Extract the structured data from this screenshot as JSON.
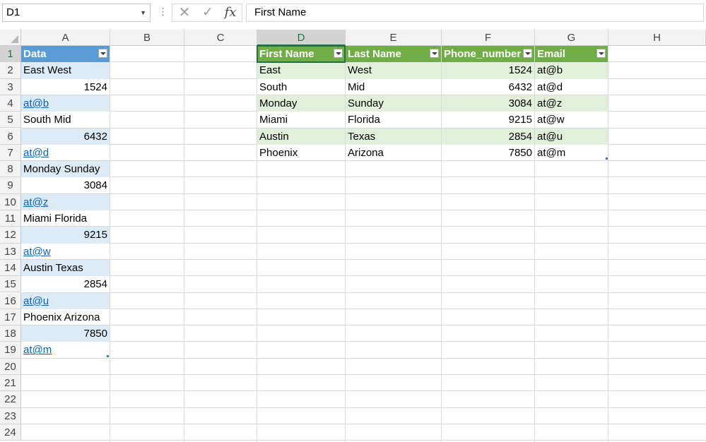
{
  "formula_bar": {
    "name_box": "D1",
    "cancel_icon": "✕",
    "enter_icon": "✓",
    "fx_label": "fx",
    "content": "First Name"
  },
  "columns": [
    "A",
    "B",
    "C",
    "D",
    "E",
    "F",
    "G",
    "H"
  ],
  "rows": [
    "1",
    "2",
    "3",
    "4",
    "5",
    "6",
    "7",
    "8",
    "9",
    "10",
    "11",
    "12",
    "13",
    "14",
    "15",
    "16",
    "17",
    "18",
    "19",
    "20",
    "21",
    "22",
    "23",
    "24"
  ],
  "column_a": {
    "header": "Data",
    "values": [
      "East West",
      "1524",
      "at@b",
      "South Mid",
      "6432",
      "at@d",
      "Monday Sunday",
      "3084",
      "at@z",
      "Miami Florida",
      "9215",
      "at@w",
      "Austin Texas",
      "2854",
      "at@u",
      "Phoenix Arizona",
      "7850",
      "at@m"
    ]
  },
  "table": {
    "headers": [
      "First Name",
      "Last Name",
      "Phone_number",
      "Email"
    ],
    "rows": [
      [
        "East",
        "West",
        "1524",
        "at@b"
      ],
      [
        "South",
        "Mid",
        "6432",
        "at@d"
      ],
      [
        "Monday",
        "Sunday",
        "3084",
        "at@z"
      ],
      [
        "Miami",
        "Florida",
        "9215",
        "at@w"
      ],
      [
        "Austin",
        "Texas",
        "2854",
        "at@u"
      ],
      [
        "Phoenix",
        "Arizona",
        "7850",
        "at@m"
      ]
    ]
  },
  "colors": {
    "blue_header": "#5b9bd5",
    "blue_band": "#ddebf7",
    "green_header": "#70ad47",
    "green_band": "#e2efda",
    "selection": "#217346",
    "hyperlink": "#0563c1"
  }
}
